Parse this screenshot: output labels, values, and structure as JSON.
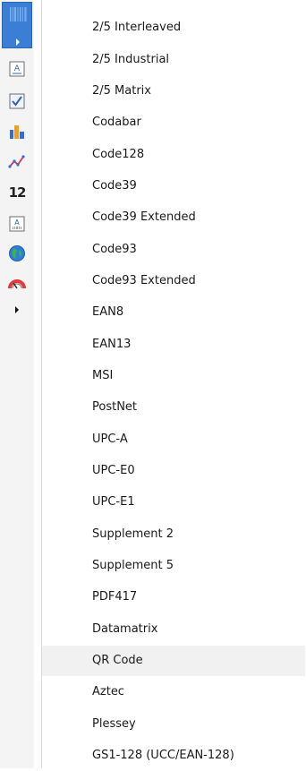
{
  "toolbar": {
    "buttons": [
      {
        "icon": "barcode-icon"
      },
      {
        "icon": "text-icon"
      },
      {
        "icon": "checkbox-icon"
      },
      {
        "icon": "bar-chart-icon"
      },
      {
        "icon": "line-chart-icon"
      },
      {
        "icon": "numeric-icon",
        "label": "12"
      },
      {
        "icon": "picture-icon"
      },
      {
        "icon": "globe-icon"
      },
      {
        "icon": "gauge-icon"
      },
      {
        "icon": "expand-arrow-icon"
      }
    ],
    "accent_color": "#3a7fd5"
  },
  "menu": {
    "items": [
      {
        "label": "2/5 Interleaved"
      },
      {
        "label": "2/5 Industrial"
      },
      {
        "label": "2/5 Matrix"
      },
      {
        "label": "Codabar"
      },
      {
        "label": "Code128"
      },
      {
        "label": "Code39"
      },
      {
        "label": "Code39 Extended"
      },
      {
        "label": "Code93"
      },
      {
        "label": "Code93 Extended"
      },
      {
        "label": "EAN8"
      },
      {
        "label": "EAN13"
      },
      {
        "label": "MSI"
      },
      {
        "label": "PostNet"
      },
      {
        "label": "UPC-A"
      },
      {
        "label": "UPC-E0"
      },
      {
        "label": "UPC-E1"
      },
      {
        "label": "Supplement 2"
      },
      {
        "label": "Supplement 5"
      },
      {
        "label": "PDF417"
      },
      {
        "label": "Datamatrix"
      },
      {
        "label": "QR Code",
        "selected": true
      },
      {
        "label": "Aztec"
      },
      {
        "label": "Plessey"
      },
      {
        "label": "GS1-128 (UCC/EAN-128)"
      }
    ]
  }
}
